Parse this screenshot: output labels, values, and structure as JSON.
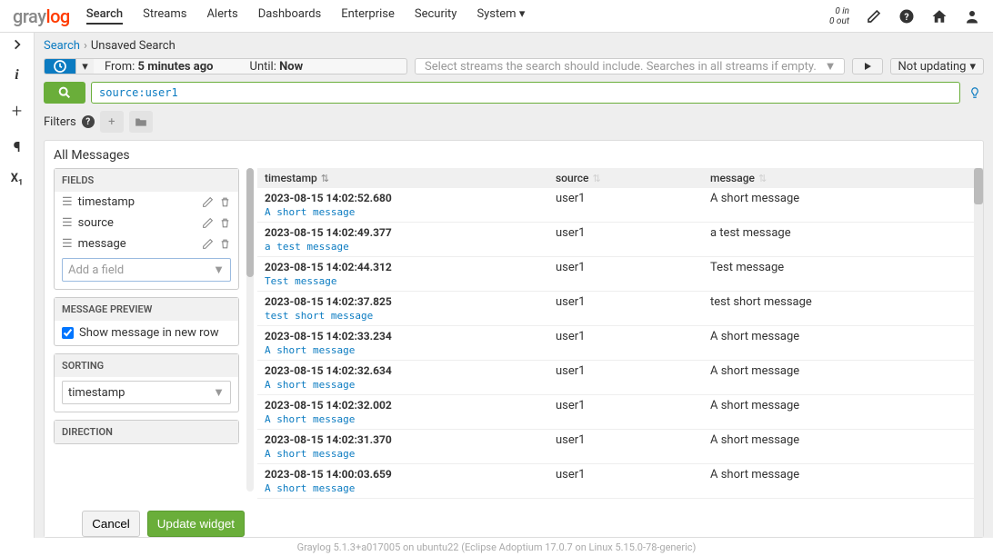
{
  "logo": {
    "p1": "gray",
    "p2": "log"
  },
  "nav": [
    "Search",
    "Streams",
    "Alerts",
    "Dashboards",
    "Enterprise",
    "Security",
    "System"
  ],
  "io": {
    "in": "0 in",
    "out": "0 out"
  },
  "breadcrumb": {
    "root": "Search",
    "current": "Unsaved Search"
  },
  "time": {
    "from_label": "From:",
    "from_value": "5 minutes ago",
    "until_label": "Until:",
    "until_value": "Now"
  },
  "stream_placeholder": "Select streams the search should include. Searches in all streams if empty.",
  "update_label": "Not updating",
  "query": "source:user1",
  "filters_label": "Filters",
  "panel_title": "All Messages",
  "fields_header": "FIELDS",
  "fields": [
    "timestamp",
    "source",
    "message"
  ],
  "add_field_placeholder": "Add a field",
  "preview_header": "MESSAGE PREVIEW",
  "preview_check": "Show message in new row",
  "sorting_header": "SORTING",
  "sorting_value": "timestamp",
  "direction_header": "DIRECTION",
  "cancel": "Cancel",
  "update": "Update widget",
  "columns": {
    "ts": "timestamp",
    "src": "source",
    "msg": "message"
  },
  "rows": [
    {
      "ts": "2023-08-15 14:02:52.680",
      "src": "user1",
      "msg": "A short message",
      "prev": "A short message"
    },
    {
      "ts": "2023-08-15 14:02:49.377",
      "src": "user1",
      "msg": "a test message",
      "prev": "a test message"
    },
    {
      "ts": "2023-08-15 14:02:44.312",
      "src": "user1",
      "msg": "Test message",
      "prev": "Test message"
    },
    {
      "ts": "2023-08-15 14:02:37.825",
      "src": "user1",
      "msg": "test short message",
      "prev": "test short message"
    },
    {
      "ts": "2023-08-15 14:02:33.234",
      "src": "user1",
      "msg": "A short message",
      "prev": "A short message"
    },
    {
      "ts": "2023-08-15 14:02:32.634",
      "src": "user1",
      "msg": "A short message",
      "prev": "A short message"
    },
    {
      "ts": "2023-08-15 14:02:32.002",
      "src": "user1",
      "msg": "A short message",
      "prev": "A short message"
    },
    {
      "ts": "2023-08-15 14:02:31.370",
      "src": "user1",
      "msg": "A short message",
      "prev": "A short message"
    },
    {
      "ts": "2023-08-15 14:00:03.659",
      "src": "user1",
      "msg": "A short message",
      "prev": "A short message"
    }
  ],
  "footer": "Graylog 5.1.3+a017005 on ubuntu22 (Eclipse Adoptium 17.0.7 on Linux 5.15.0-78-generic)"
}
